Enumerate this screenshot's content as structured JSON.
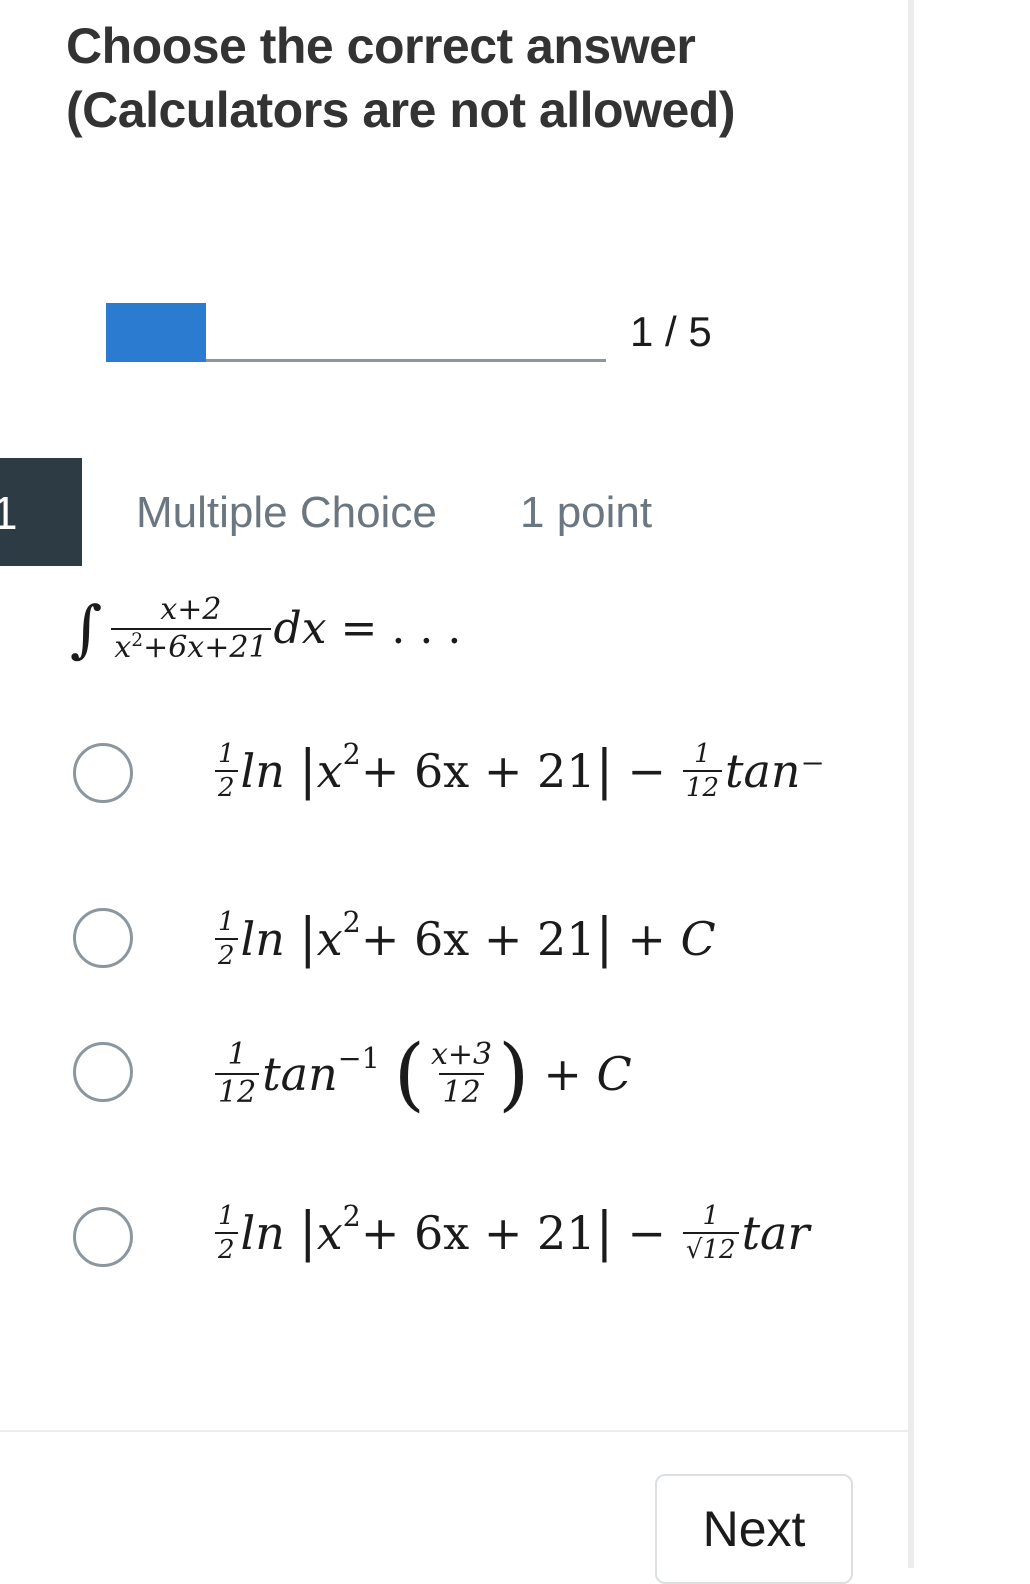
{
  "header": {
    "title_line1": "Choose the correct answer",
    "title_line2": "(Calculators are not allowed)"
  },
  "progress": {
    "current": 1,
    "total": 5,
    "fraction": 0.2,
    "label": "1 / 5"
  },
  "question": {
    "number": "1",
    "type": "Multiple Choice",
    "points": "1 point",
    "integral_sign": "∫",
    "numerator": "x+2",
    "denominator_base": "x",
    "denominator_exp": "2",
    "denominator_rest": "+6x+21",
    "dx": "dx",
    "equals": "= . . ."
  },
  "choices": [
    {
      "half_num": "1",
      "half_den": "2",
      "ln": "ln",
      "bar": "|",
      "x": "x",
      "exp": "2",
      "rest": " + 6x + 21",
      "minus": "−",
      "coef_num": "1",
      "coef_den": "12",
      "tail": "tan⁻"
    },
    {
      "half_num": "1",
      "half_den": "2",
      "ln": "ln",
      "bar": "|",
      "x": "x",
      "exp": "2",
      "rest": " + 6x + 21",
      "tail": "+ C"
    },
    {
      "coef_num": "1",
      "coef_den": "12",
      "tan": "tan",
      "exp": "−1",
      "open_paren": "(",
      "inner_num": "x+3",
      "inner_den": "12",
      "close_paren": ")",
      "tail": "+ C"
    },
    {
      "half_num": "1",
      "half_den": "2",
      "ln": "ln",
      "bar": "|",
      "x": "x",
      "exp": "2",
      "rest": " + 6x + 21",
      "minus": "−",
      "coef_num": "1",
      "coef_den": "√12",
      "tail": "tar"
    }
  ],
  "footer": {
    "next_label": "Next"
  },
  "colors": {
    "accent": "#2b7bd0",
    "dark": "#2d3b45",
    "muted": "#6b7780",
    "border": "#8b969e"
  }
}
